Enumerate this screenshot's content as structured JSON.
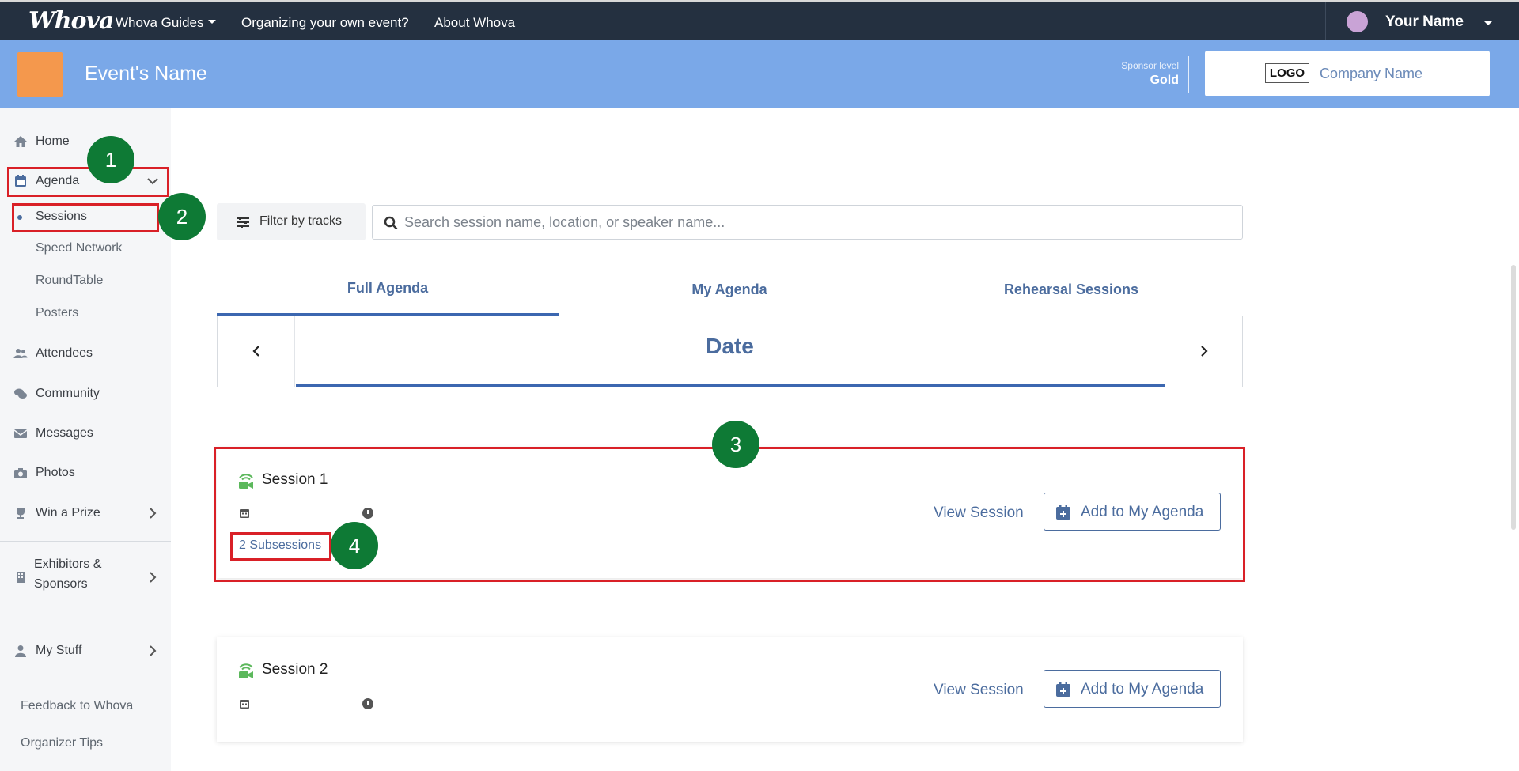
{
  "topnav": {
    "logo": "Whova",
    "links": [
      "Whova Guides",
      "Organizing your own event?",
      "About Whova"
    ],
    "user_name": "Your Name"
  },
  "banner": {
    "event_name": "Event's Name",
    "sponsor_label": "Sponsor level",
    "sponsor_level": "Gold",
    "logo_text": "LOGO",
    "company_name": "Company Name"
  },
  "sidebar": {
    "home": "Home",
    "agenda": "Agenda",
    "agenda_sub": [
      "Sessions",
      "Speed Network",
      "RoundTable",
      "Posters"
    ],
    "attendees": "Attendees",
    "community": "Community",
    "messages": "Messages",
    "photos": "Photos",
    "win_a_prize": "Win a Prize",
    "exhibitors_line1": "Exhibitors &",
    "exhibitors_line2": "Sponsors",
    "my_stuff": "My Stuff",
    "feedback": "Feedback to Whova",
    "organizer_tips": "Organizer Tips"
  },
  "main": {
    "filter_label": "Filter by tracks",
    "search_placeholder": "Search session name, location, or speaker name...",
    "tabs": [
      "Full Agenda",
      "My Agenda",
      "Rehearsal Sessions"
    ],
    "date_title": "Date",
    "sessions": [
      {
        "title": "Session 1",
        "view_label": "View Session",
        "add_label": "Add to My Agenda",
        "subsessions": "2 Subsessions"
      },
      {
        "title": "Session 2",
        "view_label": "View Session",
        "add_label": "Add to My Agenda"
      }
    ]
  },
  "annotations": [
    "1",
    "2",
    "3",
    "4"
  ],
  "colors": {
    "topnav_bg": "#243040",
    "banner_bg": "#7aa8e8",
    "accent": "#4b6c9e",
    "annotation_red": "#d92027",
    "annotation_green": "#0e7a35"
  }
}
